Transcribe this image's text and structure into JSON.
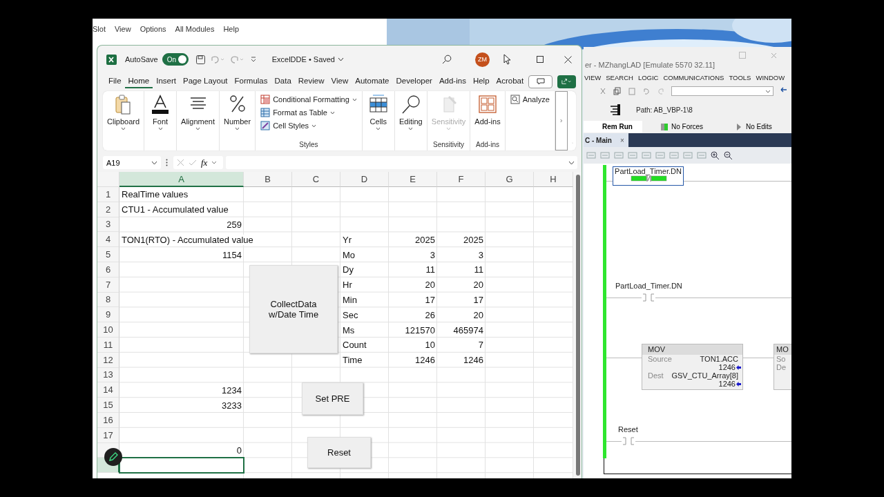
{
  "background_window": {
    "menu": [
      "Slot",
      "View",
      "Options",
      "All Modules",
      "Help"
    ]
  },
  "excel": {
    "autosave": {
      "label": "AutoSave",
      "state": "On",
      "on": true
    },
    "title": "ExcelDDE • Saved",
    "avatar": "ZM",
    "tabs": [
      {
        "label": "File",
        "selected": false
      },
      {
        "label": "Home",
        "selected": true
      },
      {
        "label": "Insert",
        "selected": false
      },
      {
        "label": "Page Layout",
        "selected": false
      },
      {
        "label": "Formulas",
        "selected": false
      },
      {
        "label": "Data",
        "selected": false
      },
      {
        "label": "Review",
        "selected": false
      },
      {
        "label": "View",
        "selected": false
      },
      {
        "label": "Automate",
        "selected": false
      },
      {
        "label": "Developer",
        "selected": false
      },
      {
        "label": "Add-ins",
        "selected": false
      },
      {
        "label": "Help",
        "selected": false
      },
      {
        "label": "Acrobat",
        "selected": false
      }
    ],
    "ribbon": {
      "groups": [
        {
          "kind": "large",
          "buttons": [
            {
              "kind": "clipboard",
              "label": "Clipboard",
              "menu": true,
              "disabled": false
            }
          ]
        },
        {
          "kind": "large",
          "buttons": [
            {
              "kind": "font",
              "label": "Font",
              "menu": true,
              "disabled": false
            }
          ]
        },
        {
          "kind": "large",
          "buttons": [
            {
              "kind": "alignment",
              "label": "Alignment",
              "menu": true,
              "disabled": false
            }
          ]
        },
        {
          "kind": "large",
          "buttons": [
            {
              "kind": "number",
              "label": "Number",
              "menu": true,
              "disabled": false
            }
          ]
        },
        {
          "kind": "stack",
          "label": "Styles",
          "buttons": [
            {
              "kind": "conditional",
              "label": "Conditional Formatting",
              "menu": true,
              "disabled": false
            },
            {
              "kind": "table",
              "label": "Format as Table",
              "menu": true,
              "disabled": false
            },
            {
              "kind": "styles",
              "label": "Cell Styles",
              "menu": true,
              "disabled": false
            }
          ]
        },
        {
          "kind": "large",
          "buttons": [
            {
              "kind": "cells",
              "label": "Cells",
              "menu": true,
              "disabled": false
            }
          ]
        },
        {
          "kind": "large",
          "buttons": [
            {
              "kind": "editing",
              "label": "Editing",
              "menu": true,
              "disabled": false
            }
          ]
        },
        {
          "kind": "large",
          "label": "Sensitivity",
          "buttons": [
            {
              "kind": "sensitivity",
              "label": "Sensitivity",
              "menu": true,
              "disabled": true
            }
          ]
        },
        {
          "kind": "large",
          "label": "Add-ins",
          "buttons": [
            {
              "kind": "addins",
              "label": "Add-ins",
              "menu": false,
              "disabled": false
            }
          ]
        },
        {
          "kind": "stack",
          "buttons": [
            {
              "kind": "analyze",
              "label": "Analyze",
              "menu": false,
              "disabled": false
            }
          ]
        }
      ]
    },
    "formula_bar": {
      "name_box": "A19",
      "fx": "fx"
    },
    "columns": [
      {
        "label": "A",
        "selected": true
      },
      {
        "label": "B",
        "selected": false
      },
      {
        "label": "C",
        "selected": false
      },
      {
        "label": "D",
        "selected": false
      },
      {
        "label": "E",
        "selected": false
      },
      {
        "label": "F",
        "selected": false
      },
      {
        "label": "G",
        "selected": false
      },
      {
        "label": "H",
        "selected": false
      }
    ],
    "rows": [
      {
        "num": "1",
        "selected": false,
        "cells": {
          "a": {
            "kind": "text",
            "text": "RealTime values"
          }
        }
      },
      {
        "num": "2",
        "selected": false,
        "cells": {
          "a": {
            "kind": "text",
            "text": "CTU1 - Accumulated value"
          }
        }
      },
      {
        "num": "3",
        "selected": false,
        "cells": {
          "a": {
            "kind": "number",
            "text": "259"
          }
        }
      },
      {
        "num": "4",
        "selected": false,
        "cells": {
          "a": {
            "kind": "text",
            "text": "TON1(RTO) - Accumulated value"
          },
          "d": {
            "kind": "text",
            "text": "Yr"
          },
          "e": {
            "kind": "number",
            "text": "2025"
          },
          "f": {
            "kind": "number",
            "text": "2025"
          }
        }
      },
      {
        "num": "5",
        "selected": false,
        "cells": {
          "a": {
            "kind": "number",
            "text": "1154"
          },
          "d": {
            "kind": "text",
            "text": "Mo"
          },
          "e": {
            "kind": "number",
            "text": "3"
          },
          "f": {
            "kind": "number",
            "text": "3"
          }
        }
      },
      {
        "num": "6",
        "selected": false,
        "cells": {
          "d": {
            "kind": "text",
            "text": "Dy"
          },
          "e": {
            "kind": "number",
            "text": "11"
          },
          "f": {
            "kind": "number",
            "text": "11"
          }
        }
      },
      {
        "num": "7",
        "selected": false,
        "cells": {
          "d": {
            "kind": "text",
            "text": "Hr"
          },
          "e": {
            "kind": "number",
            "text": "20"
          },
          "f": {
            "kind": "number",
            "text": "20"
          }
        }
      },
      {
        "num": "8",
        "selected": false,
        "cells": {
          "d": {
            "kind": "text",
            "text": "Min"
          },
          "e": {
            "kind": "number",
            "text": "17"
          },
          "f": {
            "kind": "number",
            "text": "17"
          }
        }
      },
      {
        "num": "9",
        "selected": false,
        "cells": {
          "d": {
            "kind": "text",
            "text": "Sec"
          },
          "e": {
            "kind": "number",
            "text": "26"
          },
          "f": {
            "kind": "number",
            "text": "20"
          }
        }
      },
      {
        "num": "10",
        "selected": false,
        "cells": {
          "d": {
            "kind": "text",
            "text": "Ms"
          },
          "e": {
            "kind": "number",
            "text": "121570"
          },
          "f": {
            "kind": "number",
            "text": "465974"
          }
        }
      },
      {
        "num": "11",
        "selected": false,
        "cells": {
          "d": {
            "kind": "text",
            "text": "Count"
          },
          "e": {
            "kind": "number",
            "text": "10"
          },
          "f": {
            "kind": "number",
            "text": "7"
          }
        }
      },
      {
        "num": "12",
        "selected": false,
        "cells": {
          "d": {
            "kind": "text",
            "text": "Time"
          },
          "e": {
            "kind": "number",
            "text": "1246"
          },
          "f": {
            "kind": "number",
            "text": "1246"
          }
        }
      },
      {
        "num": "13",
        "selected": false
      },
      {
        "num": "14",
        "selected": false,
        "cells": {
          "a": {
            "kind": "number",
            "text": "1234"
          }
        }
      },
      {
        "num": "15",
        "selected": false,
        "cells": {
          "a": {
            "kind": "number",
            "text": "3233"
          }
        }
      },
      {
        "num": "16",
        "selected": false
      },
      {
        "num": "17",
        "selected": false
      },
      {
        "selected": false,
        "cells": {
          "a": {
            "kind": "number",
            "text": "0"
          }
        }
      },
      {
        "selected": true
      }
    ],
    "sheet_buttons": [
      {
        "label": "CollectData w/Date Time"
      },
      {
        "label": "Set PRE"
      },
      {
        "label": "Reset"
      }
    ]
  },
  "logix": {
    "title": "er - MZhangLAD [Emulate 5570 32.11]",
    "menu": [
      "VIEW",
      "SEARCH",
      "LOGIC",
      "COMMUNICATIONS",
      "TOOLS",
      "WINDOW"
    ],
    "path": "Path: AB_VBP-1\\8",
    "status": [
      "Rem Run",
      "No Forces",
      "No Edits"
    ],
    "tab": {
      "label": "C - Main",
      "close": "×"
    },
    "rungs": [
      {
        "kind": "xio",
        "tag": "PartLoad_Timer.DN",
        "selected": true,
        "energized": true
      },
      {
        "kind": "xic",
        "tag": "PartLoad_Timer.DN",
        "selected": false,
        "energized": false
      },
      {
        "kind": "mov",
        "blocks": [
          {
            "title": "MOV",
            "rows": [
              {
                "label": "Source",
                "tag": "TON1.ACC",
                "value": "1246"
              },
              {
                "label": "Dest",
                "tag": "GSV_CTU_Array[8]",
                "value": "1246"
              }
            ]
          },
          {
            "title": "MO",
            "rows": [
              {
                "label": "So"
              },
              {
                "label": "De"
              }
            ]
          }
        ]
      },
      {
        "kind": "xic",
        "tag": "Reset",
        "selected": false,
        "energized": false
      }
    ]
  }
}
